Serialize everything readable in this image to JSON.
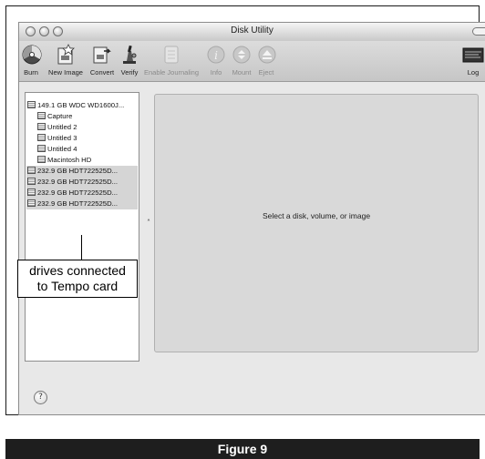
{
  "window": {
    "title": "Disk Utility"
  },
  "toolbar": {
    "items": [
      {
        "label": "Burn",
        "icon": "burn-icon",
        "enabled": true
      },
      {
        "label": "New Image",
        "icon": "new-image-icon",
        "enabled": true
      },
      {
        "label": "Convert",
        "icon": "convert-icon",
        "enabled": true
      },
      {
        "label": "Verify",
        "icon": "verify-icon",
        "enabled": true
      },
      {
        "label": "Enable Journaling",
        "icon": "enable-journaling-icon",
        "enabled": false
      },
      {
        "label": "Info",
        "icon": "info-icon",
        "enabled": false
      },
      {
        "label": "Mount",
        "icon": "mount-icon",
        "enabled": false
      },
      {
        "label": "Eject",
        "icon": "eject-icon",
        "enabled": false
      },
      {
        "label": "Log",
        "icon": "log-icon",
        "enabled": true
      }
    ]
  },
  "sidebar": {
    "items": [
      {
        "label": "149.1 GB WDC WD1600J...",
        "indent": false,
        "selected": false
      },
      {
        "label": "Capture",
        "indent": true,
        "selected": false
      },
      {
        "label": "Untitled 2",
        "indent": true,
        "selected": false
      },
      {
        "label": "Untitled 3",
        "indent": true,
        "selected": false
      },
      {
        "label": "Untitled 4",
        "indent": true,
        "selected": false
      },
      {
        "label": "Macintosh HD",
        "indent": true,
        "selected": false
      },
      {
        "label": "232.9 GB HDT722525D...",
        "indent": false,
        "selected": true
      },
      {
        "label": "232.9 GB HDT722525D...",
        "indent": false,
        "selected": true
      },
      {
        "label": "232.9 GB HDT722525D...",
        "indent": false,
        "selected": true
      },
      {
        "label": "232.9 GB HDT722525D...",
        "indent": false,
        "selected": true
      }
    ]
  },
  "main": {
    "message": "Select a disk, volume, or image"
  },
  "help": {
    "label": "?"
  },
  "callout": {
    "line1": "drives connected",
    "line2": "to Tempo card"
  },
  "figure": {
    "caption": "Figure 9"
  },
  "colors": {
    "window_bg": "#e8e8e8",
    "selection": "#d5d5d5",
    "figure_bar": "#1e1e1e"
  }
}
